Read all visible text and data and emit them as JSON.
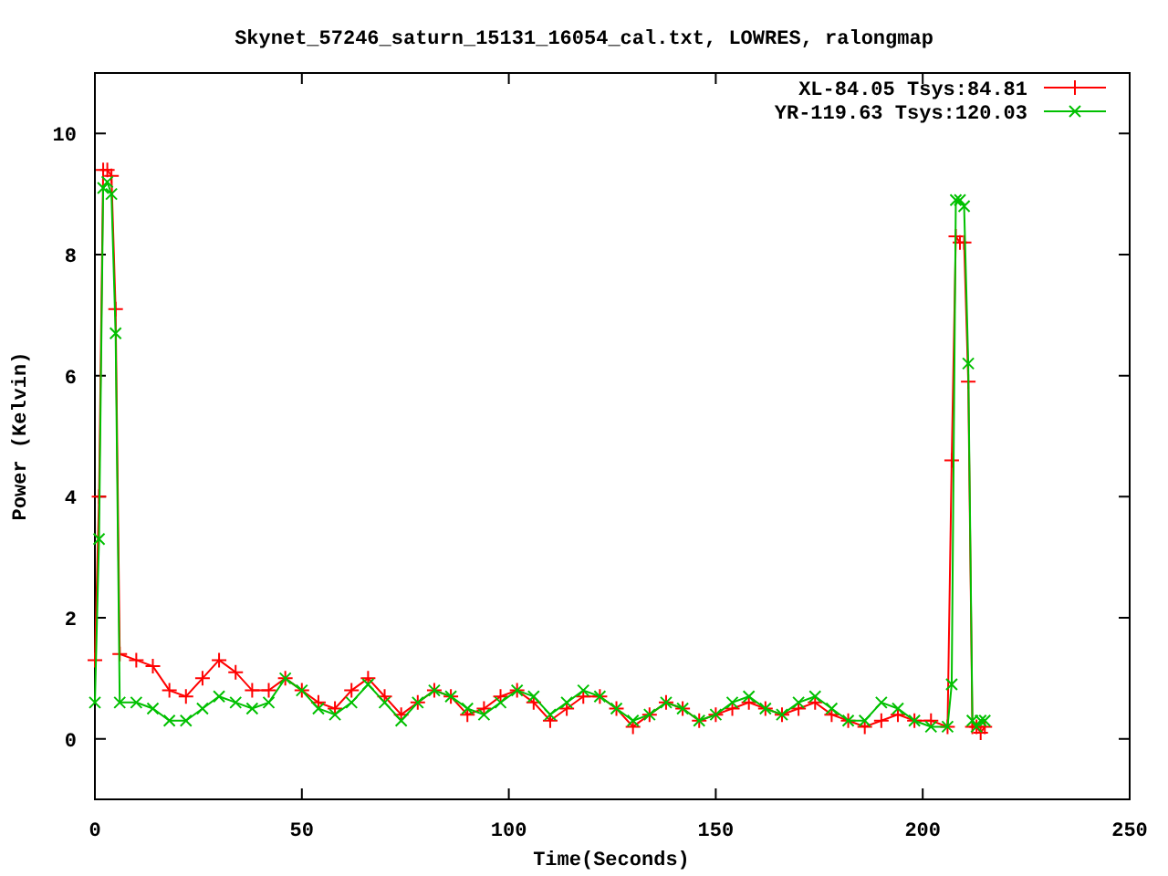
{
  "chart_data": {
    "type": "line",
    "title": "Skynet_57246_saturn_15131_16054_cal.txt, LOWRES, ralongmap",
    "xlabel": "Time(Seconds)",
    "ylabel": "Power (Kelvin)",
    "xlim": [
      0,
      250
    ],
    "ylim": [
      -1,
      11
    ],
    "xticks": [
      0,
      50,
      100,
      150,
      200,
      250
    ],
    "yticks": [
      0,
      2,
      4,
      6,
      8,
      10
    ],
    "legend": true,
    "x": [
      0,
      1,
      2,
      3,
      4,
      5,
      6,
      10,
      14,
      18,
      22,
      26,
      30,
      34,
      38,
      42,
      46,
      50,
      54,
      58,
      62,
      66,
      70,
      74,
      78,
      82,
      86,
      90,
      94,
      98,
      102,
      106,
      110,
      114,
      118,
      122,
      126,
      130,
      134,
      138,
      142,
      146,
      150,
      154,
      158,
      162,
      166,
      170,
      174,
      178,
      182,
      186,
      190,
      194,
      198,
      202,
      206,
      207,
      208,
      209,
      210,
      211,
      212,
      213,
      214,
      215
    ],
    "series": [
      {
        "name": "XL-84.05 Tsys:84.81",
        "color": "#ff0000",
        "marker": "plus",
        "values": [
          1.3,
          4.0,
          9.4,
          9.4,
          9.3,
          7.1,
          1.4,
          1.3,
          1.2,
          0.8,
          0.7,
          1.0,
          1.3,
          1.1,
          0.8,
          0.8,
          1.0,
          0.8,
          0.6,
          0.5,
          0.8,
          1.0,
          0.7,
          0.4,
          0.6,
          0.8,
          0.7,
          0.4,
          0.5,
          0.7,
          0.8,
          0.6,
          0.3,
          0.5,
          0.7,
          0.7,
          0.5,
          0.2,
          0.4,
          0.6,
          0.5,
          0.3,
          0.4,
          0.5,
          0.6,
          0.5,
          0.4,
          0.5,
          0.6,
          0.4,
          0.3,
          0.2,
          0.3,
          0.4,
          0.3,
          0.3,
          0.2,
          4.6,
          8.3,
          8.2,
          8.2,
          5.9,
          0.2,
          0.2,
          0.1,
          0.2
        ]
      },
      {
        "name": "YR-119.63 Tsys:120.03",
        "color": "#00c000",
        "marker": "cross",
        "values": [
          0.6,
          3.3,
          9.1,
          9.2,
          9.0,
          6.7,
          0.6,
          0.6,
          0.5,
          0.3,
          0.3,
          0.5,
          0.7,
          0.6,
          0.5,
          0.6,
          1.0,
          0.8,
          0.5,
          0.4,
          0.6,
          0.9,
          0.6,
          0.3,
          0.6,
          0.8,
          0.7,
          0.5,
          0.4,
          0.6,
          0.8,
          0.7,
          0.4,
          0.6,
          0.8,
          0.7,
          0.5,
          0.3,
          0.4,
          0.6,
          0.5,
          0.3,
          0.4,
          0.6,
          0.7,
          0.5,
          0.4,
          0.6,
          0.7,
          0.5,
          0.3,
          0.3,
          0.6,
          0.5,
          0.3,
          0.2,
          0.2,
          0.9,
          8.9,
          8.9,
          8.8,
          6.2,
          0.3,
          0.2,
          0.3,
          0.3
        ]
      }
    ]
  }
}
